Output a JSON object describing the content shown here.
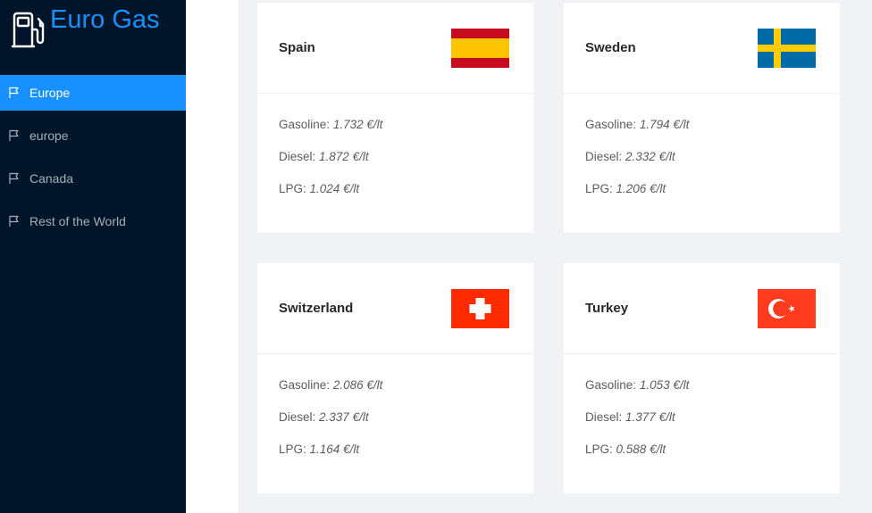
{
  "app": {
    "title": "Euro Gas",
    "logo_icon": "gas-pump-icon",
    "brand_color": "#1890ff",
    "sidebar_bg": "#001529"
  },
  "menu": {
    "items": [
      {
        "label": "Europe",
        "icon": "flag-icon",
        "active": true
      },
      {
        "label": "europe",
        "icon": "flag-icon",
        "active": false
      },
      {
        "label": "Canada",
        "icon": "flag-icon",
        "active": false
      },
      {
        "label": "Rest of the World",
        "icon": "flag-icon",
        "active": false
      }
    ]
  },
  "price_labels": {
    "gasoline": "Gasoline:",
    "diesel": "Diesel:",
    "lpg": "LPG:"
  },
  "cards": [
    {
      "country": "Spain",
      "flag": "spain-flag",
      "gasoline": "1.732 €/lt",
      "diesel": "1.872 €/lt",
      "lpg": "1.024 €/lt"
    },
    {
      "country": "Sweden",
      "flag": "sweden-flag",
      "gasoline": "1.794 €/lt",
      "diesel": "2.332 €/lt",
      "lpg": "1.206 €/lt"
    },
    {
      "country": "Switzerland",
      "flag": "switzerland-flag",
      "gasoline": "2.086 €/lt",
      "diesel": "2.337 €/lt",
      "lpg": "1.164 €/lt"
    },
    {
      "country": "Turkey",
      "flag": "turkey-flag",
      "gasoline": "1.053 €/lt",
      "diesel": "1.377 €/lt",
      "lpg": "0.588 €/lt"
    }
  ]
}
